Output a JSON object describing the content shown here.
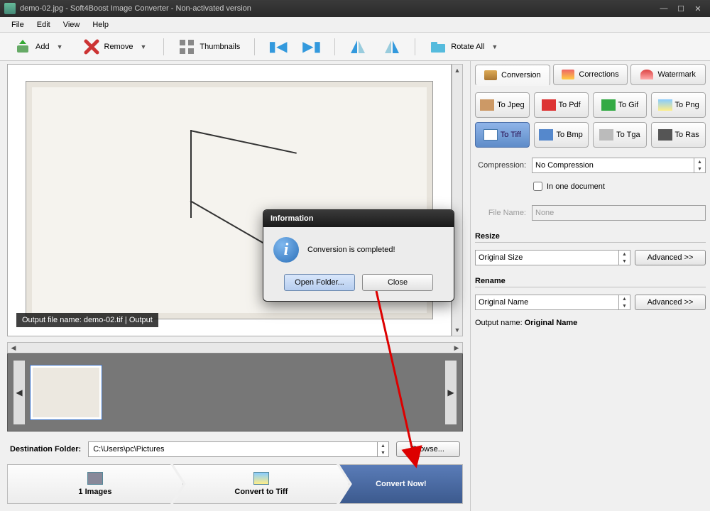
{
  "titlebar": {
    "title": "demo-02.jpg - Soft4Boost Image Converter - Non-activated version"
  },
  "menu": {
    "file": "File",
    "edit": "Edit",
    "view": "View",
    "help": "Help"
  },
  "toolbar": {
    "add": "Add",
    "remove": "Remove",
    "thumbnails": "Thumbnails",
    "rotate": "Rotate All"
  },
  "preview": {
    "overlay": "Output file name: demo-02.tif | Output"
  },
  "dest": {
    "label": "Destination Folder:",
    "path": "C:\\Users\\pc\\Pictures",
    "browse": "Browse..."
  },
  "chevrons": {
    "images": "1 Images",
    "convert_to": "Convert to Tiff",
    "convert_now": "Convert Now!"
  },
  "tabs": {
    "conversion": "Conversion",
    "corrections": "Corrections",
    "watermark": "Watermark"
  },
  "formats": {
    "jpeg": "To Jpeg",
    "pdf": "To Pdf",
    "gif": "To Gif",
    "png": "To Png",
    "tiff": "To Tiff",
    "bmp": "To Bmp",
    "tga": "To Tga",
    "ras": "To Ras"
  },
  "options": {
    "compression_label": "Compression:",
    "compression_value": "No Compression",
    "in_one_doc": "In one document",
    "filename_label": "File Name:",
    "filename_value": "None"
  },
  "resize": {
    "header": "Resize",
    "value": "Original Size",
    "advanced": "Advanced >>"
  },
  "rename": {
    "header": "Rename",
    "value": "Original Name",
    "advanced": "Advanced >>",
    "output_label": "Output name: ",
    "output_value": "Original Name"
  },
  "dialog": {
    "title": "Information",
    "message": "Conversion is completed!",
    "open_folder": "Open Folder...",
    "close": "Close"
  }
}
